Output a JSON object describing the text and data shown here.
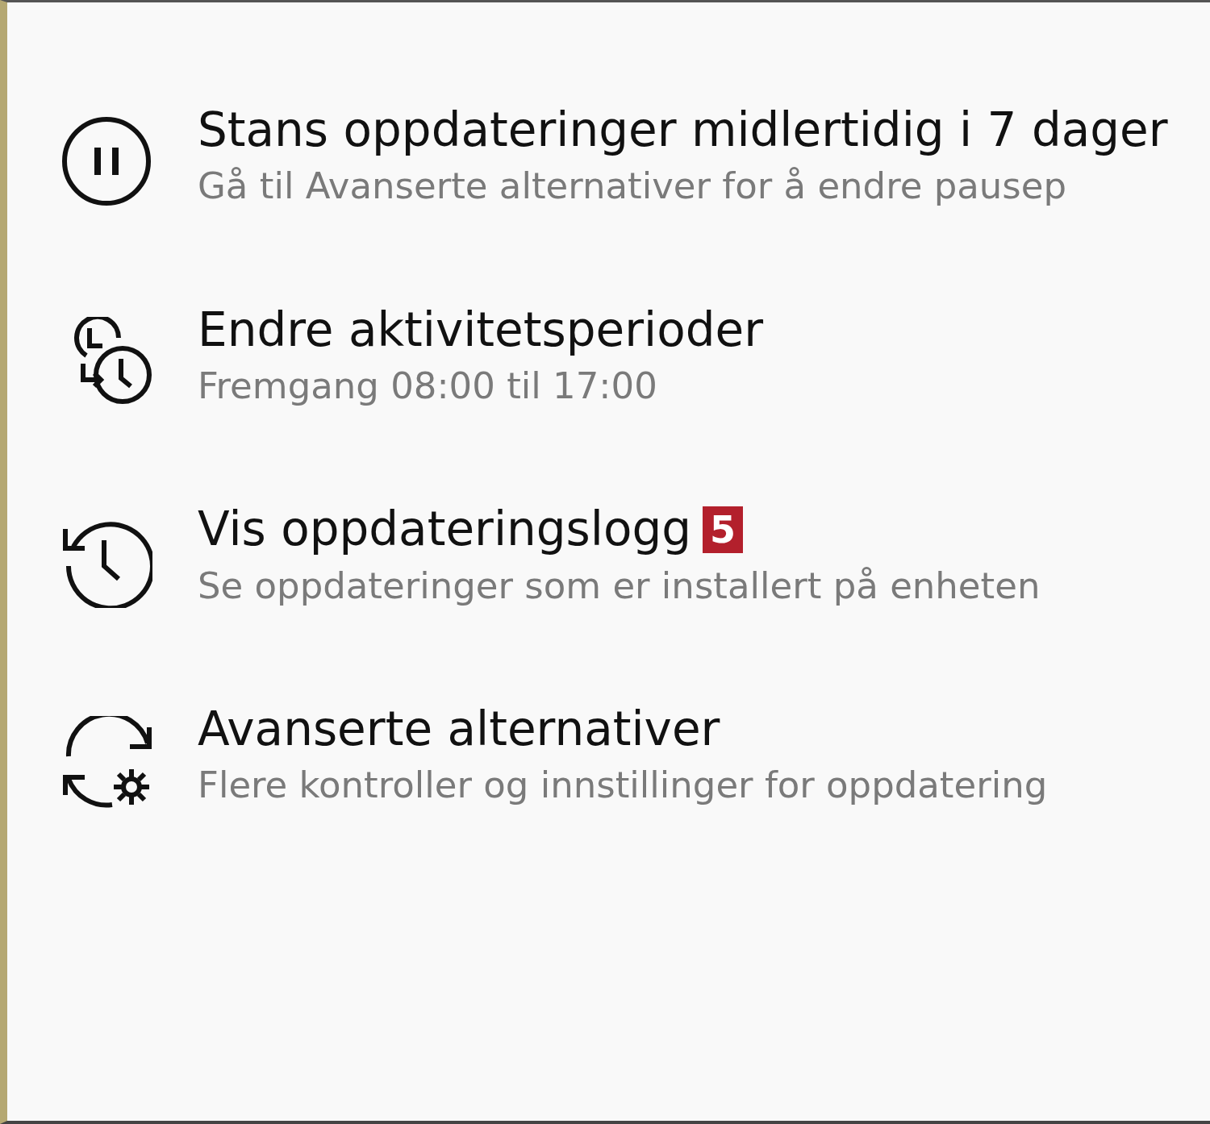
{
  "options": [
    {
      "title": "Stans oppdateringer midlertidig i 7 dager",
      "subtitle": "Gå til Avanserte alternativer for å endre pausep"
    },
    {
      "title": "Endre aktivitetsperioder",
      "subtitle": "Fremgang 08:00 til 17:00"
    },
    {
      "title": "Vis oppdateringslogg",
      "badge": "5",
      "subtitle": "Se oppdateringer som er installert på enheten"
    },
    {
      "title": "Avanserte alternativer",
      "subtitle": "Flere kontroller og innstillinger for oppdatering"
    }
  ]
}
